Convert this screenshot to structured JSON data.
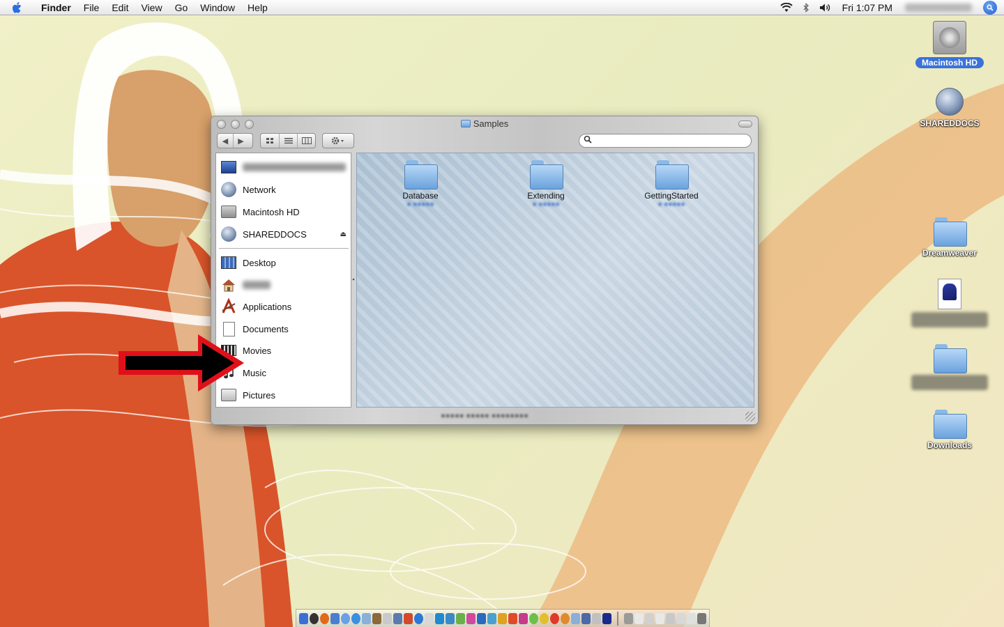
{
  "menubar": {
    "app_name": "Finder",
    "menus": [
      "File",
      "Edit",
      "View",
      "Go",
      "Window",
      "Help"
    ],
    "clock": "Fri 1:07 PM"
  },
  "desktop": {
    "icons": [
      {
        "label": "Macintosh HD",
        "icon": "hard-drive-icon",
        "selected": true
      },
      {
        "label": "SHAREDDOCS",
        "icon": "network-volume-icon"
      },
      {
        "label": "Dreamweaver",
        "icon": "folder-icon"
      },
      {
        "label": "",
        "icon": "document-icon"
      },
      {
        "label": "",
        "icon": "folder-icon"
      },
      {
        "label": "Downloads",
        "icon": "folder-icon"
      }
    ]
  },
  "finder": {
    "title": "Samples",
    "search": {
      "value": "",
      "placeholder": ""
    },
    "sidebar": {
      "devices": [
        {
          "label": "",
          "icon": "computer-icon",
          "blurred": true
        },
        {
          "label": "Network",
          "icon": "globe-icon"
        },
        {
          "label": "Macintosh HD",
          "icon": "hard-drive-icon"
        },
        {
          "label": "SHAREDDOCS",
          "icon": "network-volume-icon",
          "eject": "⏏"
        }
      ],
      "places": [
        {
          "label": "Desktop",
          "icon": "desktop-icon"
        },
        {
          "label": "",
          "icon": "home-icon",
          "blurred": true
        },
        {
          "label": "Applications",
          "icon": "applications-icon"
        },
        {
          "label": "Documents",
          "icon": "documents-icon"
        },
        {
          "label": "Movies",
          "icon": "movies-icon"
        },
        {
          "label": "Music",
          "icon": "music-icon"
        },
        {
          "label": "Pictures",
          "icon": "pictures-icon"
        }
      ]
    },
    "items": [
      {
        "name": "Database"
      },
      {
        "name": "Extending"
      },
      {
        "name": "GettingStarted"
      }
    ]
  },
  "colors": {
    "selection": "#3a72d9",
    "arrow": "#e0101a",
    "wallpaper_orange": "#d94f22"
  }
}
